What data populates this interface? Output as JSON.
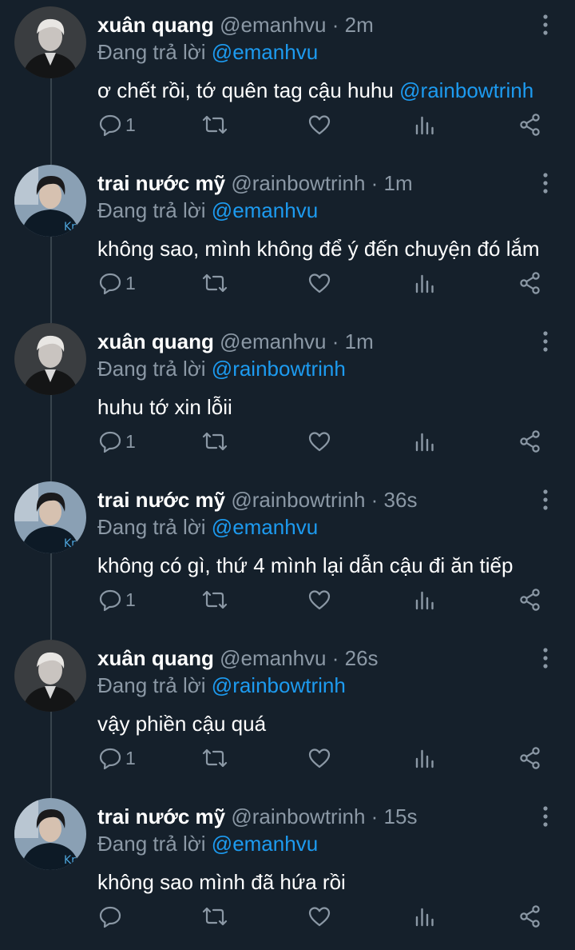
{
  "colors": {
    "background": "#15202b",
    "text": "#ffffff",
    "muted": "#8b98a5",
    "accent": "#1d9bf0",
    "thread_line": "#38444d"
  },
  "tweets": [
    {
      "name": "xuân quang",
      "handle": "@emanhvu",
      "dot": "·",
      "time": "2m",
      "reply_prefix": "Đang trả lời",
      "reply_to": "@emanhvu",
      "text": "ơ chết rồi, tớ quên tag cậu huhu",
      "text_mention": "@rainbowtrinh",
      "reply_count": "1",
      "avatar": "avatar-xuan-quang"
    },
    {
      "name": "trai nước mỹ",
      "handle": "@rainbowtrinh",
      "dot": "·",
      "time": "1m",
      "reply_prefix": "Đang trả lời",
      "reply_to": "@emanhvu",
      "text": "không sao, mình không để ý đến chuyện đó lắm",
      "text_mention": "",
      "reply_count": "1",
      "avatar": "avatar-trai-nuoc-my"
    },
    {
      "name": "xuân quang",
      "handle": "@emanhvu",
      "dot": "·",
      "time": "1m",
      "reply_prefix": "Đang trả lời",
      "reply_to": "@rainbowtrinh",
      "text": "huhu tớ xin lỗii",
      "text_mention": "",
      "reply_count": "1",
      "avatar": "avatar-xuan-quang"
    },
    {
      "name": "trai nước mỹ",
      "handle": "@rainbowtrinh",
      "dot": "·",
      "time": "36s",
      "reply_prefix": "Đang trả lời",
      "reply_to": "@emanhvu",
      "text": "không có gì, thứ 4 mình lại dẫn cậu đi ăn tiếp",
      "text_mention": "",
      "reply_count": "1",
      "avatar": "avatar-trai-nuoc-my"
    },
    {
      "name": "xuân quang",
      "handle": "@emanhvu",
      "dot": "·",
      "time": "26s",
      "reply_prefix": "Đang trả lời",
      "reply_to": "@rainbowtrinh",
      "text": "vậy phiền cậu quá",
      "text_mention": "",
      "reply_count": "1",
      "avatar": "avatar-xuan-quang"
    },
    {
      "name": "trai nước mỹ",
      "handle": "@rainbowtrinh",
      "dot": "·",
      "time": "15s",
      "reply_prefix": "Đang trả lời",
      "reply_to": "@emanhvu",
      "text": "không sao mình đã hứa rồi",
      "text_mention": "",
      "reply_count": "",
      "avatar": "avatar-trai-nuoc-my"
    }
  ],
  "icons": {
    "reply": "reply-icon",
    "retweet": "retweet-icon",
    "like": "like-icon",
    "analytics": "analytics-icon",
    "share": "share-icon",
    "more": "more-icon"
  }
}
